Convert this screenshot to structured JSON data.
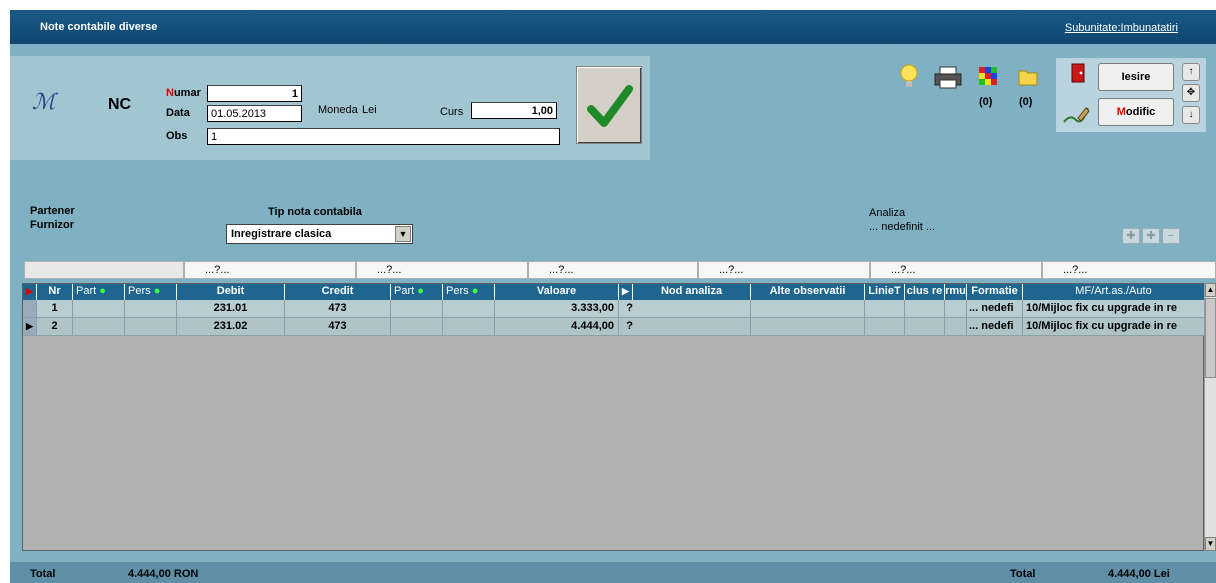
{
  "window": {
    "title": "Note contabile diverse",
    "subunit": "Subunitate:Imbunatatiri"
  },
  "header": {
    "doc_type": "NC",
    "numar_label": "Numar",
    "numar_value": "1",
    "data_label": "Data",
    "data_value": "01.05.2013",
    "obs_label": "Obs",
    "obs_value": "1",
    "moneda_label": "Moneda",
    "moneda_value": "Lei",
    "curs_label": "Curs",
    "curs_value": "1,00"
  },
  "toolbar": {
    "count_cube": "(0)",
    "count_folder": "(0)",
    "iesire_label": "Iesire",
    "modific_label": "Modific"
  },
  "form": {
    "partener_label": "Partener",
    "furnizor_label": "Furnizor",
    "tip_label": "Tip nota contabila",
    "tip_value": "Inregistrare clasica",
    "analiza_label": "Analiza",
    "analiza_value": "... nedefinit ..."
  },
  "filters": [
    "...?...",
    "...?...",
    "...?...",
    "...?...",
    "...?...",
    "...?..."
  ],
  "grid": {
    "columns": [
      "Nr",
      "Part",
      "Pers",
      "Debit",
      "Credit",
      "Part",
      "Pers",
      "Valoare",
      "Nod analiza",
      "Alte observatii",
      "LinieT",
      "clus re",
      "rmu",
      "Formatie",
      "MF/Art.as./Auto"
    ],
    "rows": [
      {
        "nr": "1",
        "debit": "231.01",
        "credit": "473",
        "valoare": "3.333,00",
        "q": "?",
        "formatie": "... nedefi",
        "mf": "10/Mijloc fix cu upgrade in re"
      },
      {
        "nr": "2",
        "debit": "231.02",
        "credit": "473",
        "valoare": "4.444,00",
        "q": "?",
        "formatie": "... nedefi",
        "mf": "10/Mijloc fix cu upgrade in re"
      }
    ]
  },
  "footer": {
    "total_label_left": "Total",
    "total_value_left": "4.444,00 RON",
    "total_label_right": "Total",
    "total_value_right": "4.444,00 Lei"
  }
}
